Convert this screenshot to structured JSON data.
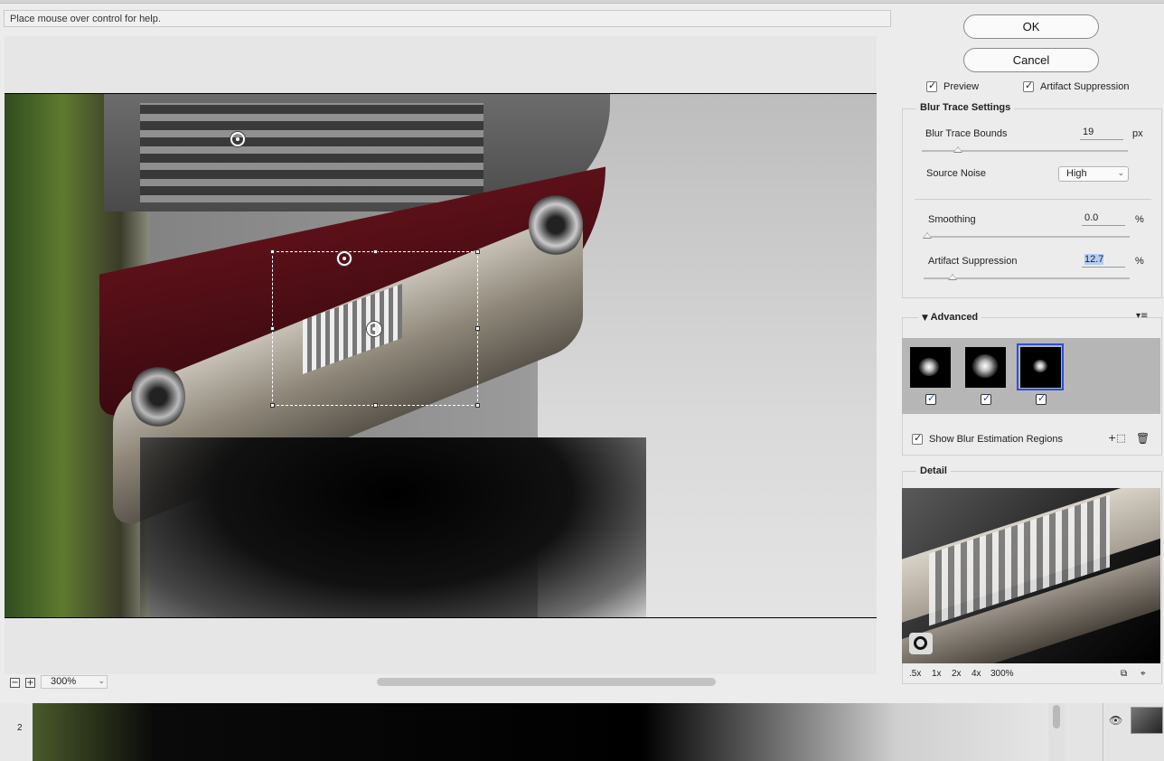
{
  "help_text": "Place mouse over control for help.",
  "buttons": {
    "ok": "OK",
    "cancel": "Cancel"
  },
  "options": {
    "preview": "Preview",
    "artifact_suppression": "Artifact Suppression"
  },
  "blur_trace": {
    "title": "Blur Trace Settings",
    "bounds_label": "Blur Trace Bounds",
    "bounds_value": "19",
    "bounds_unit": "px",
    "noise_label": "Source Noise",
    "noise_value": "High",
    "smoothing_label": "Smoothing",
    "smoothing_value": "0.0",
    "smoothing_unit": "%",
    "artifact_label": "Artifact Suppression",
    "artifact_value": "12.7",
    "artifact_unit": "%"
  },
  "advanced": {
    "title": "Advanced",
    "show_regions_label": "Show Blur Estimation Regions",
    "kernels": [
      "blur-kernel-1",
      "blur-kernel-2",
      "blur-kernel-3"
    ],
    "selected_kernel": 3
  },
  "detail": {
    "title": "Detail",
    "zooms": [
      ".5x",
      "1x",
      "2x",
      "4x",
      "300%"
    ]
  },
  "zoom": {
    "value": "300%"
  },
  "ruler": {
    "mark": "2"
  },
  "colors": {
    "accent": "#2a4fe0",
    "dialog_bg": "#ececec"
  }
}
